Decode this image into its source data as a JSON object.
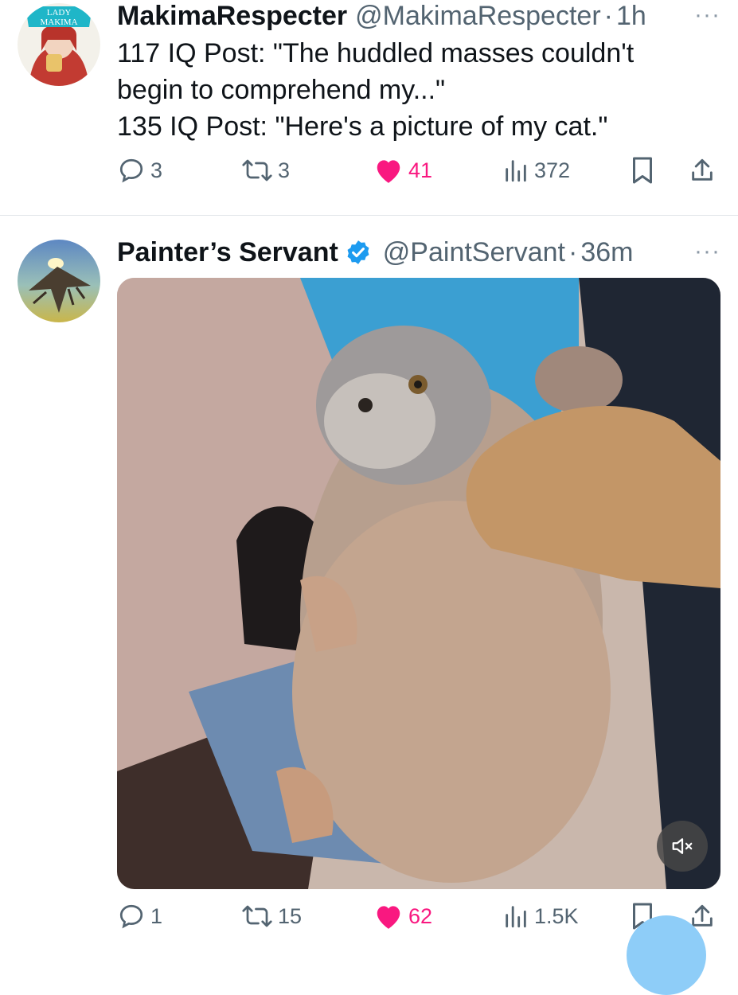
{
  "tweets": [
    {
      "display_name": "MakimaRespecter",
      "handle": "@MakimaRespecter",
      "separator": "·",
      "time": "1h",
      "more": "···",
      "avatar_caption_1": "LADY",
      "avatar_caption_2": "MAKIMA",
      "lines": [
        "117 IQ Post: \"The huddled masses couldn't",
        "begin to comprehend my...\"",
        "135 IQ Post: \"Here's a picture of my cat.\""
      ],
      "replies": "3",
      "retweets": "3",
      "likes": "41",
      "views": "372"
    },
    {
      "display_name": "Painter’s Servant",
      "handle": "@PaintServant",
      "separator": "·",
      "time": "36m",
      "more": "···",
      "verified": true,
      "media_description_icon": "muted-volume-icon",
      "replies": "1",
      "retweets": "15",
      "likes": "62",
      "views": "1.5K"
    }
  ],
  "colors": {
    "like": "#f91880",
    "secondary_text": "#536471",
    "verified": "#1d9bf0"
  }
}
